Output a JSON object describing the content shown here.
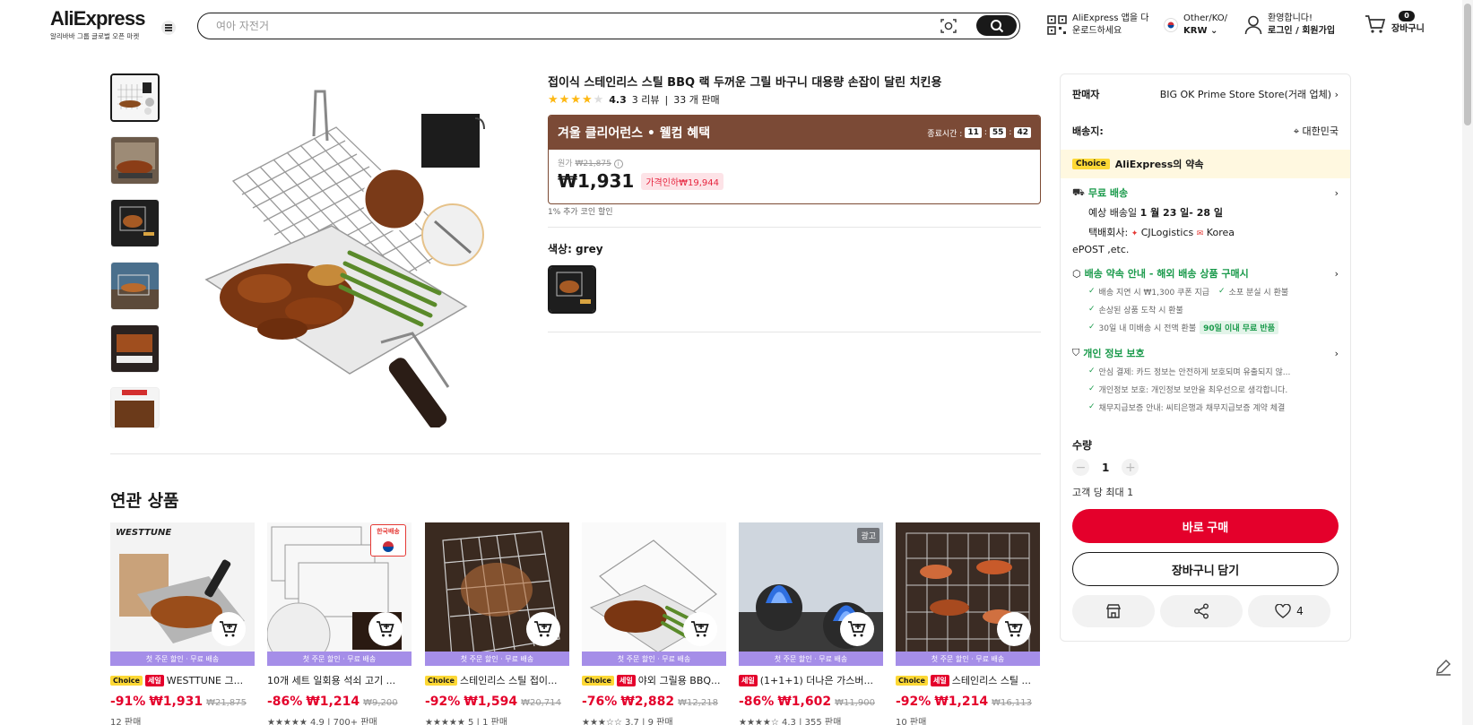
{
  "header": {
    "logo": "AliExpress",
    "logo_tagline": "알리바바 그룹 글로벌 오픈 마켓",
    "search_placeholder": "여아 자전거",
    "app_line1": "AliExpress 앱을 다",
    "app_line2": "운로드하세요",
    "region_line1": "Other/KO/",
    "region_line2": "KRW",
    "account_line1": "환영합니다!",
    "account_line2": "로그인 / 회원가입",
    "cart_count": "0",
    "cart_label": "장바구니"
  },
  "product": {
    "title": "접이식 스테인리스 스틸 BBQ 랙 두꺼운 그릴 바구니 대용량 손잡이 달린 치킨용",
    "rating": "4.3",
    "reviews": "3 리뷰",
    "sold": "33 개 판매",
    "promo_title": "겨울 클리어런스 • 웰컴 혜택",
    "timer_label": "종료시간 :",
    "timer_h": "11",
    "timer_m": "55",
    "timer_s": "42",
    "orig_label": "원가",
    "orig_price": "₩21,875",
    "price": "₩1,931",
    "discount": "가격인하₩19,944",
    "coin_note": "1% 추가 코인 할인",
    "color_label": "색상: grey"
  },
  "panel": {
    "seller_label": "판매자",
    "seller_name": "BIG OK Prime Store Store(거래 업체)",
    "ship_to_label": "배송지:",
    "ship_to": "대한민국",
    "choice_tag": "Choice",
    "choice_promise": "AliExpress의 약속",
    "free_shipping": "무료 배송",
    "delivery_prefix": "예상 배송일",
    "delivery_dates": "1 월 23 일- 28 일",
    "courier_label": "택배회사:",
    "courier_1": "CJLogistics",
    "courier_2": "Korea",
    "courier_3": "ePOST ,etc.",
    "guarantee_title": "배송 약속 안내 - 해외 배송 상품 구매시",
    "guarantee_1": "배송 지연 시 ₩1,300 쿠폰 지급",
    "guarantee_2": "소포 분실 시 환불",
    "guarantee_3": "손상된 상품 도착 시 환불",
    "guarantee_4": "30일 내 미배송 시 전액 환불",
    "guarantee_tag": "90일 이내 무료 반품",
    "privacy_title": "개인 정보 보호",
    "privacy_1": "안심 결제: 카드 정보는 안전하게 보호되며 유출되지 않...",
    "privacy_2": "개인정보 보호: 개인정보 보안을 최우선으로 생각합니다.",
    "privacy_3": "채무지급보증 안내: 씨티은행과 채무지급보증 계약 체결",
    "qty_label": "수량",
    "qty_value": "1",
    "limit": "고객 당 최대 1",
    "buy_now": "바로 구매",
    "add_cart": "장바구니 담기",
    "wishlist_count": "4"
  },
  "related": {
    "title": "연관 상품",
    "strip": "첫 주문 할인 · 무료 배송",
    "ad_label": "광고",
    "korea_ship_label": "한국배송",
    "items": [
      {
        "choice": "Choice",
        "sale": "세일",
        "name": "WESTTUNE 그...",
        "discount": "-91%",
        "price": "₩1,931",
        "orig": "₩21,875",
        "sold": "12 판매",
        "brand_text": "WESTTUNE"
      },
      {
        "choice": "",
        "sale": "",
        "name": "10개 세트 일회용 석쇠 고기 ...",
        "discount": "-86%",
        "price": "₩1,214",
        "orig": "₩9,200",
        "sold": "4.9 | 700+ 판매"
      },
      {
        "choice": "Choice",
        "sale": "",
        "name": "스테인리스 스틸 접이...",
        "discount": "-92%",
        "price": "₩1,594",
        "orig": "₩20,714",
        "sold": "5 | 1 판매"
      },
      {
        "choice": "Choice",
        "sale": "세일",
        "name": "야외 그릴용 BBQ...",
        "discount": "-76%",
        "price": "₩2,882",
        "orig": "₩12,218",
        "sold": "3.7 | 9 판매"
      },
      {
        "choice": "",
        "sale": "세일",
        "name": "(1+1+1) 더나은 가스버...",
        "discount": "-86%",
        "price": "₩1,602",
        "orig": "₩11,900",
        "sold": "4.3 | 355 판매"
      },
      {
        "choice": "Choice",
        "sale": "세일",
        "name": "스테인리스 스틸 ...",
        "discount": "-92%",
        "price": "₩1,214",
        "orig": "₩16,113",
        "sold": "10 판매"
      }
    ]
  },
  "colors": {
    "accent": "#e4002b",
    "promo": "#7b4a36",
    "choice": "#fdd835",
    "green": "#1a9a4b",
    "strip": "#a58ee8"
  }
}
